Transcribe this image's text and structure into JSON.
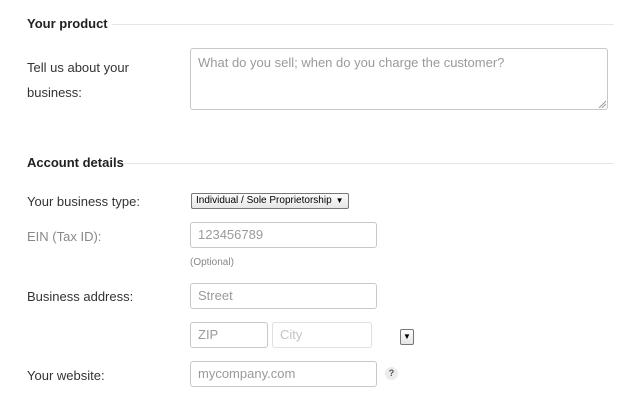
{
  "sections": {
    "product_title": "Your product",
    "account_title": "Account details"
  },
  "product": {
    "description_label_line1": "Tell us about your",
    "description_label_line2": "business:",
    "description_placeholder": "What do you sell; when do you charge the customer?"
  },
  "account": {
    "business_type_label": "Your business type:",
    "business_type_value": "Individual / Sole Proprietorship",
    "business_type_arrow": "▼",
    "ein_label": "EIN (Tax ID):",
    "ein_placeholder": "123456789",
    "ein_helper": "(Optional)",
    "address_label": "Business address:",
    "street_placeholder": "Street",
    "zip_placeholder": "ZIP",
    "city_placeholder": "City",
    "state_arrow": "▼",
    "website_label": "Your website:",
    "website_placeholder": "mycompany.com",
    "website_help": "?"
  }
}
